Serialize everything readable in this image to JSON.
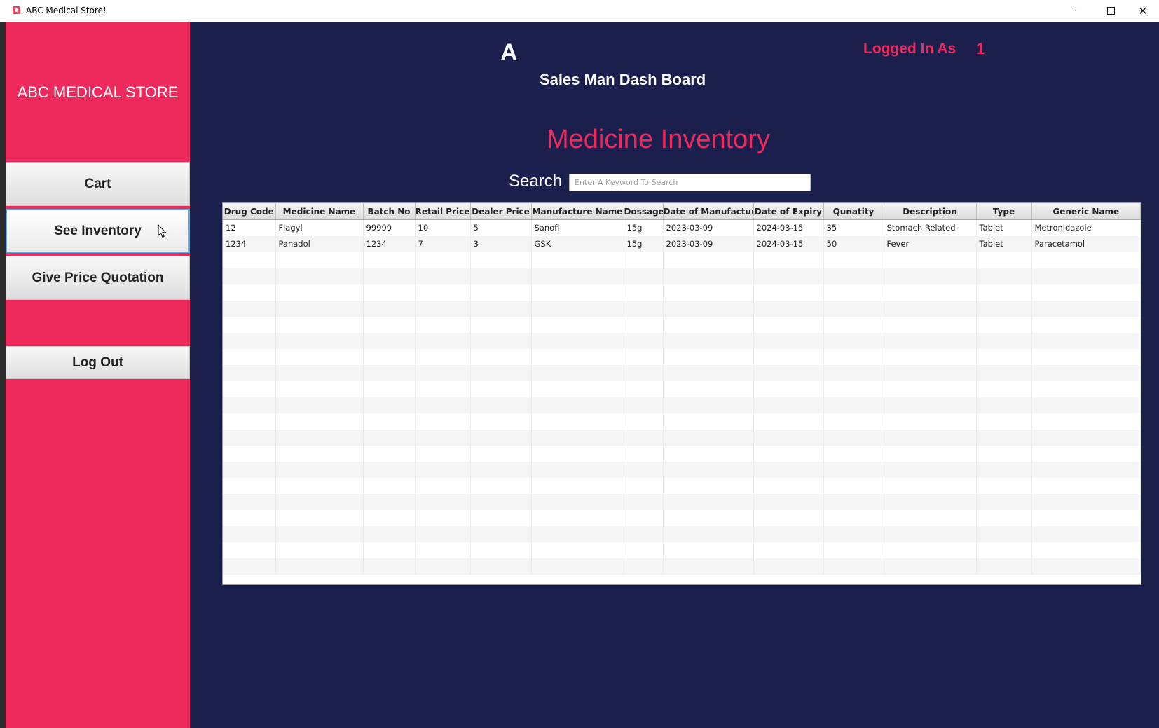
{
  "window": {
    "title": "ABC Medical Store!",
    "min_glyph": "",
    "close_glyph": "✕"
  },
  "sidebar": {
    "brand": "ABC MEDICAL STORE",
    "buttons": [
      {
        "label": "Cart"
      },
      {
        "label": "See Inventory"
      },
      {
        "label": "Give Price Quotation"
      },
      {
        "label": "Log Out"
      }
    ]
  },
  "header": {
    "initial": "A",
    "subtitle": "Sales Man Dash Board",
    "logged_in_label": "Logged In As",
    "logged_in_value": "1"
  },
  "main": {
    "title": "Medicine Inventory",
    "search_label": "Search",
    "search_placeholder": "Enter A Keyword To Search"
  },
  "table": {
    "columns": [
      "Drug Code",
      "Medicine Name",
      "Batch No",
      "Retail Price",
      "Dealer Price",
      "Manufacture Name",
      "Dossage",
      "Date of Manufacture",
      "Date of Expiry",
      "Qunatity",
      "Description",
      "Type",
      "Generic Name"
    ],
    "rows": [
      [
        "12",
        "Flagyl",
        "99999",
        "10",
        "5",
        "Sanofi",
        "15g",
        "2023-03-09",
        "2024-03-15",
        "35",
        "Stomach Related",
        "Tablet",
        "Metronidazole"
      ],
      [
        "1234",
        "Panadol",
        "1234",
        "7",
        "3",
        "GSK",
        "15g",
        "2023-03-09",
        "2024-03-15",
        "50",
        "Fever",
        "Tablet",
        "Paracetamol"
      ]
    ],
    "empty_rows": 20
  },
  "colors": {
    "background": "#1a1f4e",
    "accent": "#ee2a5d",
    "active_border": "#5aa9e0"
  }
}
